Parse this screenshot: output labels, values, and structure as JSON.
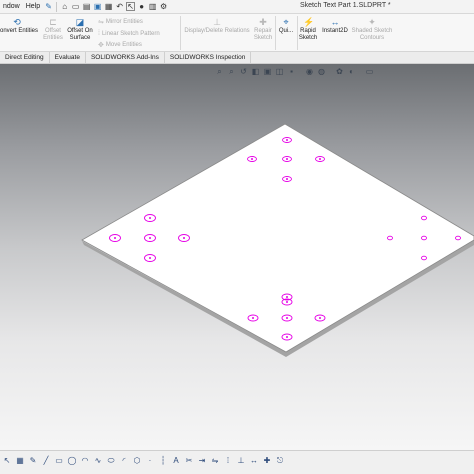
{
  "menubar": {
    "window_menu": "ndow",
    "help_menu": "Help",
    "pin_icon": "pin-icon",
    "quick_access": [
      "home-icon",
      "new-icon",
      "open-icon",
      "save-icon",
      "print-icon",
      "undo-icon",
      "select-icon",
      "rebuild-icon",
      "file-props-icon",
      "options-icon"
    ],
    "document_title": "Sketch Text Part 1.SLDPRT *"
  },
  "ribbon": {
    "convert_entities": "onvert Entities",
    "offset_entities_line1": "Offset",
    "offset_entities_line2": "Entities",
    "offset_on_surface_line1": "Offset On",
    "offset_on_surface_line2": "Surface",
    "mirror_entities": "Mirror Entities",
    "linear_sketch_pattern": "Linear Sketch Pattern",
    "move_entities": "Move Entities",
    "display_delete_relations": "Display/Delete Relations",
    "repair_sketch_line1": "Repair",
    "repair_sketch_line2": "Sketch",
    "quick_snaps": "Qui...",
    "rapid_sketch_line1": "Rapid",
    "rapid_sketch_line2": "Sketch",
    "instant2d": "Instant2D",
    "shaded_sketch_contours_line1": "Shaded Sketch",
    "shaded_sketch_contours_line2": "Contours"
  },
  "tabs": [
    {
      "label": "Direct Editing"
    },
    {
      "label": "Evaluate"
    },
    {
      "label": "SOLIDWORKS Add-Ins"
    },
    {
      "label": "SOLIDWORKS Inspection"
    }
  ],
  "colors": {
    "sketch_point": "#e600e6",
    "plate_face": "#ffffff",
    "plate_edge": "#8a8a8a",
    "accent": "#2a6fb0"
  }
}
